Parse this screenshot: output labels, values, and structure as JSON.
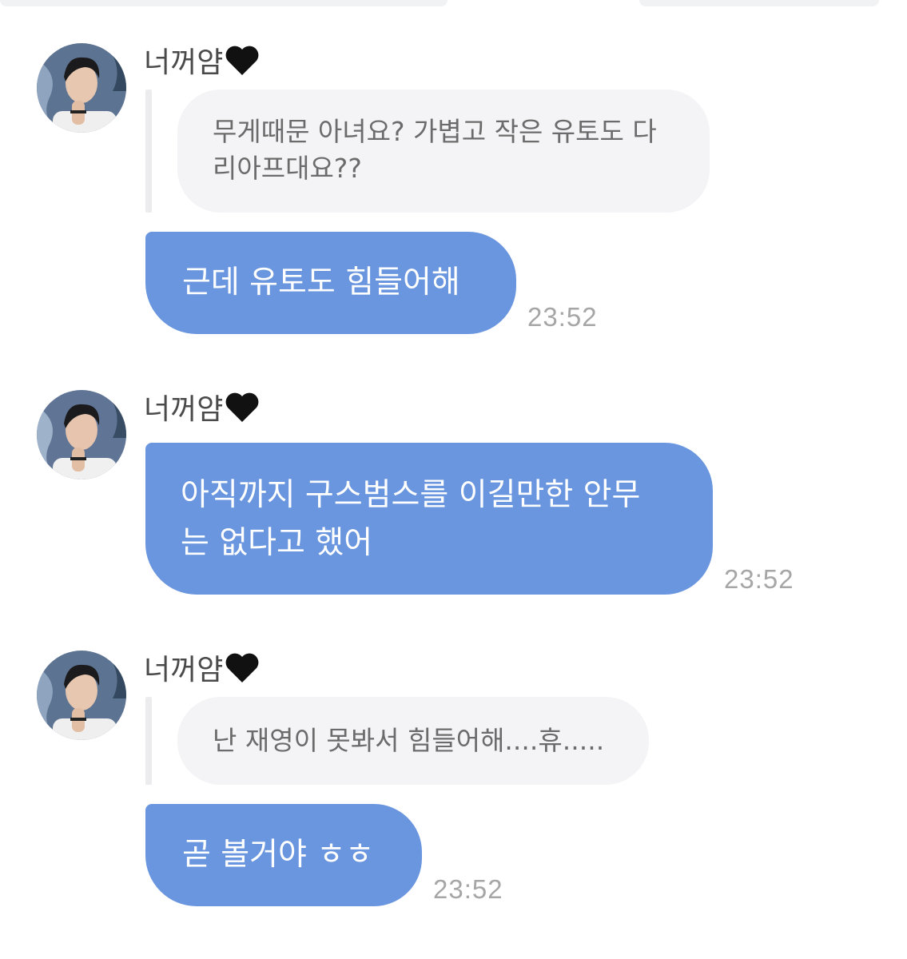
{
  "messages": [
    {
      "sender": "너꺼얌",
      "quote": "무게때문 아녀요? 가볍고 작은 유토도 다리아프대요??",
      "quote_lines": [
        "무게때문 아녀요? 가볍고 작은 유토도 다",
        "리아프대요??"
      ],
      "reply": "근데 유토도 힘들어해",
      "reply_lines": [
        "근데 유토도 힘들어해"
      ],
      "time": "23:52"
    },
    {
      "sender": "너꺼얌",
      "reply": "아직까지 구스범스를 이길만한 안무는 없다고 했어",
      "reply_lines": [
        "아직까지 구스범스를 이길만한 안무",
        "는 없다고 했어"
      ],
      "time": "23:52"
    },
    {
      "sender": "너꺼얌",
      "quote": "난 재영이 못봐서 힘들어해....휴.....",
      "quote_lines": [
        "난 재영이 못봐서 힘들어해....휴....."
      ],
      "reply": "곧 볼거야 ㅎㅎ",
      "reply_lines": [
        "곧 볼거야 ㅎㅎ"
      ],
      "time": "23:52"
    }
  ],
  "icons": {
    "heart": "black-heart-icon",
    "avatar": "profile-photo"
  },
  "colors": {
    "bubble": "#6a96df",
    "quote_bg": "#f4f4f6",
    "timestamp": "#a6a6a6"
  }
}
